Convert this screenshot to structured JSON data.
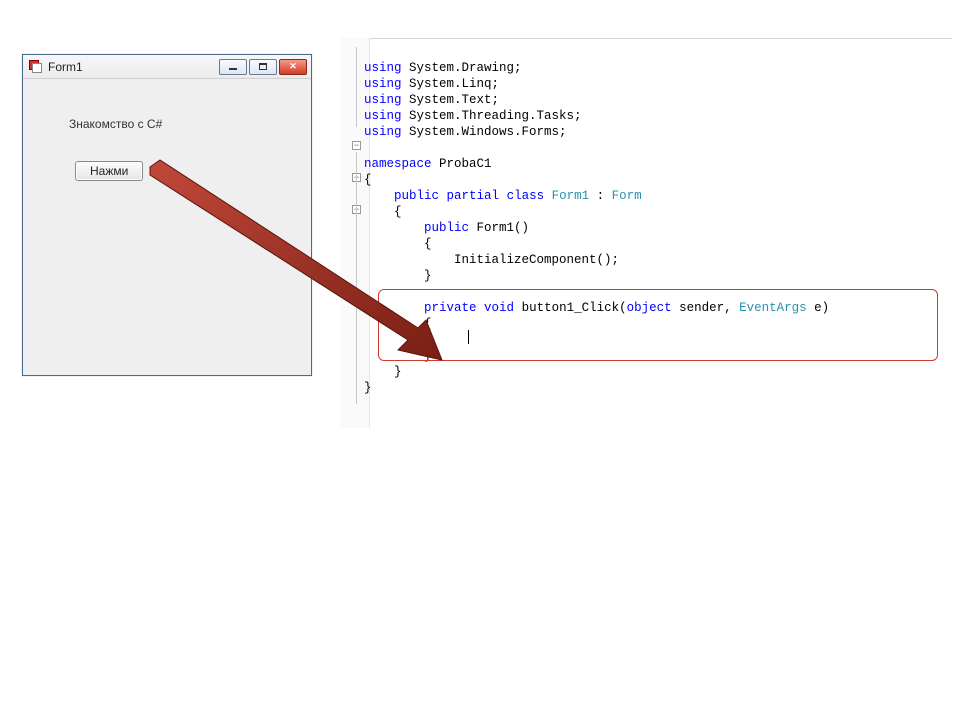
{
  "form": {
    "title": "Form1",
    "label_text": "Знакомство с C#",
    "button_label": "Нажми",
    "icon_name": "form-icon",
    "controls": {
      "minimize": "minimize-icon",
      "maximize": "maximize-icon",
      "close": "close-icon",
      "close_glyph": "✕"
    }
  },
  "code_lines": {
    "l1": "using System.Drawing;",
    "l2": "using System.Linq;",
    "l3": "using System.Text;",
    "l4": "using System.Threading.Tasks;",
    "l5": "using System.Windows.Forms;",
    "blank1": "",
    "ns": "namespace ProbaC1",
    "ob1": "{",
    "cls1a": "public",
    "cls1b": "partial",
    "cls1c": "class",
    "cls_name": "Form1",
    "cls_colon": " : ",
    "cls_base": "Form",
    "ob2": "    {",
    "ctor_kw": "public",
    "ctor_name": " Form1()",
    "ob3": "        {",
    "init": "            InitializeComponent();",
    "cb3": "        }",
    "blank2": "",
    "m_kw1": "private",
    "m_kw2": "void",
    "m_name": " button1_Click(",
    "m_obj": "object",
    "m_send": " sender, ",
    "m_ea": "EventArgs",
    "m_e": " e)",
    "ob4": "        {",
    "body": "            ",
    "cb4": "        }",
    "cb2": "    }",
    "cb1": "}"
  },
  "fold_glyph_minus": "−",
  "colors": {
    "keyword": "#0000ff",
    "type": "#2b91af",
    "highlight_border": "#cf3b2e",
    "arrow_fill": "#9a2a1d"
  }
}
